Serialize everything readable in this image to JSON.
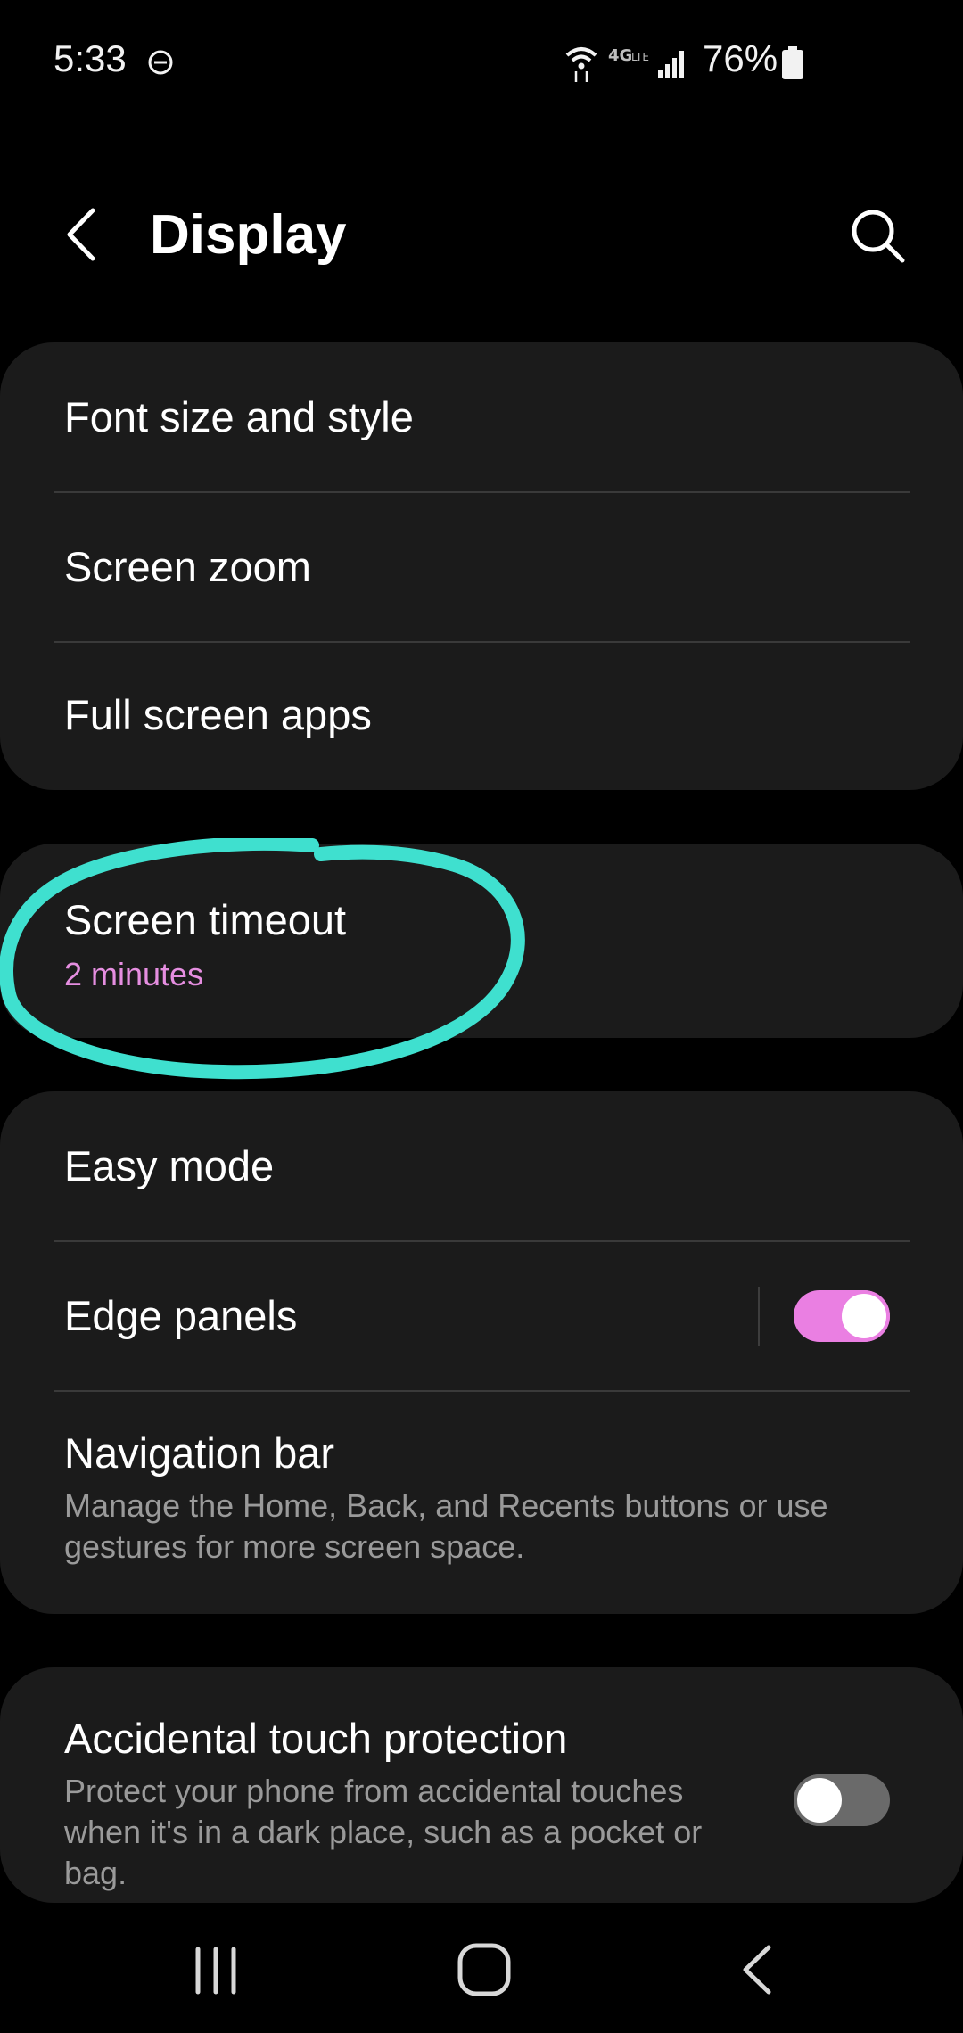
{
  "status_bar": {
    "time": "5:33",
    "battery": "76%",
    "icons": [
      "do-not-disturb-icon",
      "wifi-icon",
      "lte-icon",
      "signal-icon",
      "battery-icon"
    ]
  },
  "header": {
    "title": "Display",
    "back_icon": "back-arrow-icon",
    "search_icon": "search-icon"
  },
  "groups": {
    "text": {
      "font_size": "Font size and style",
      "screen_zoom": "Screen zoom",
      "full_screen_apps": "Full screen apps"
    },
    "timeout": {
      "title": "Screen timeout",
      "value": "2 minutes"
    },
    "modes": {
      "easy_mode": "Easy mode",
      "edge_panels": {
        "title": "Edge panels",
        "enabled": true
      },
      "navigation_bar": {
        "title": "Navigation bar",
        "description": "Manage the Home, Back, and Recents buttons or use gestures for more screen space."
      }
    },
    "protection": {
      "title": "Accidental touch protection",
      "description": "Protect your phone from accidental touches when it's in a dark place, such as a pocket or bag.",
      "enabled": false
    }
  },
  "colors": {
    "accent": "#ea7fe2",
    "card_bg": "#1b1b1b",
    "annotation": "#3fe0cf",
    "description": "#9a9a9a"
  },
  "nav_bar": {
    "icons": [
      "recents-icon",
      "home-icon",
      "back-icon"
    ]
  }
}
